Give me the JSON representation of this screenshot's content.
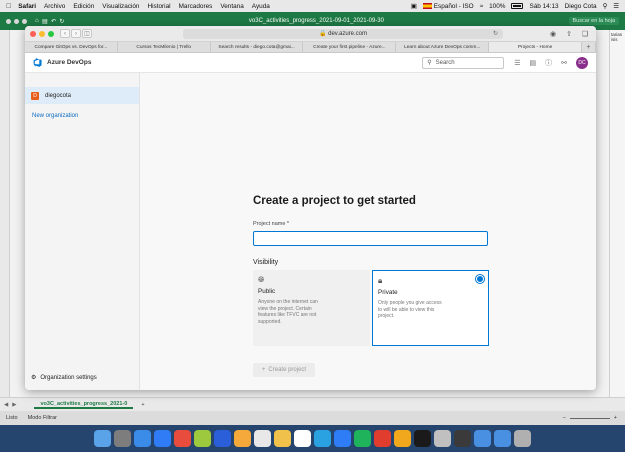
{
  "menubar": {
    "app": "Safari",
    "items": [
      "Archivo",
      "Edición",
      "Visualización",
      "Historial",
      "Marcadores",
      "Ventana",
      "Ayuda"
    ],
    "language": "Español - ISO",
    "battery": "100%",
    "datetime": "Sáb 14:13",
    "user": "Diego Cota"
  },
  "excel": {
    "title": "vo3C_activities_progress_2021-09-01_2021-09-30",
    "search_placeholder": "Buscar en la hoja",
    "sheet_tab": "vo3C_activities_progress_2021-0",
    "status_left": "Listo",
    "status_mode": "Modo Filtrar",
    "right_pane": "tarias isis"
  },
  "safari": {
    "address": "dev.azure.com",
    "tabs": [
      "Compare GitOps vs. DevOps for...",
      "Cursos TecMilenio | Trello",
      "Search results - diego.cota@gmai...",
      "Create your first pipeline - Azure...",
      "Learn about Azure DevOps comm...",
      "Projects - Home"
    ]
  },
  "ado": {
    "brand": "Azure DevOps",
    "search_placeholder": "Search",
    "avatar_initials": "DC",
    "org_name": "diegocota",
    "org_initial": "D",
    "new_org": "New organization",
    "org_settings": "Organization settings",
    "heading": "Create a project to get started",
    "project_name_label": "Project name *",
    "visibility_label": "Visibility",
    "public_title": "Public",
    "public_desc": "Anyone on the internet can view the project. Certain features like TFVC are not supported.",
    "private_title": "Private",
    "private_desc": "Only people you give access to will be able to view this project.",
    "selected_visibility": "Private",
    "create_button": "Create project"
  }
}
